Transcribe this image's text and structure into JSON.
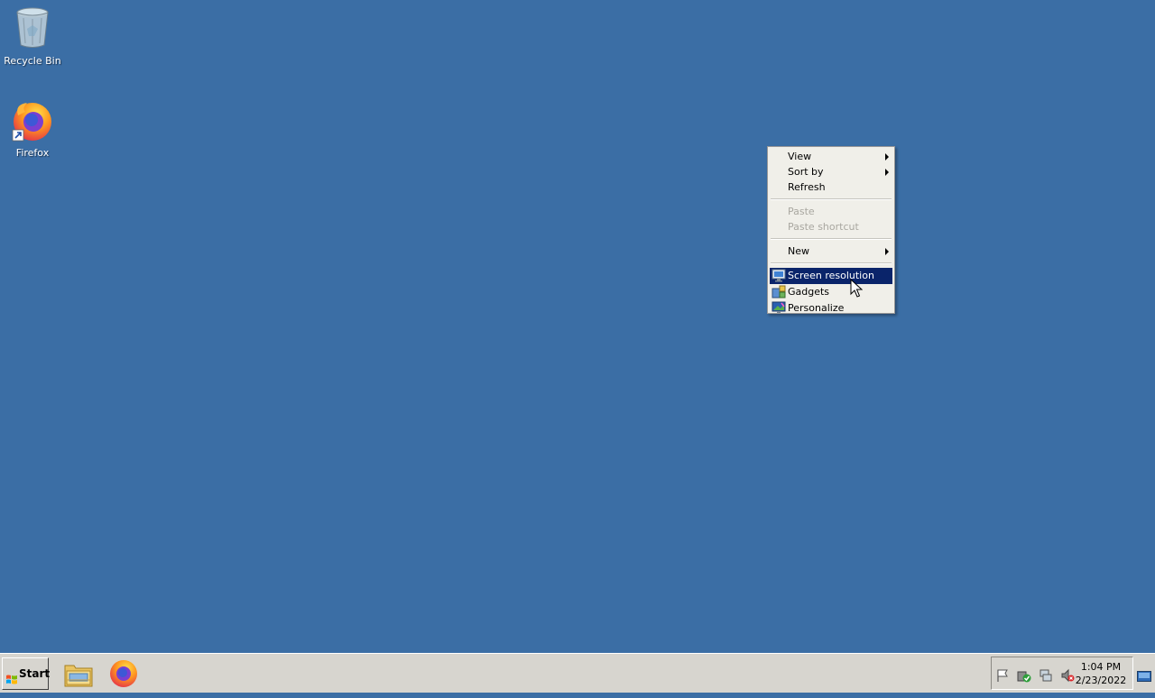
{
  "desktop": {
    "background_color": "#3b6ea5",
    "icons": [
      {
        "label": "Recycle Bin",
        "icon": "recycle-bin-icon"
      },
      {
        "label": "Firefox",
        "icon": "firefox-icon"
      }
    ]
  },
  "context_menu": {
    "items": [
      {
        "label": "View",
        "submenu": true,
        "enabled": true
      },
      {
        "label": "Sort by",
        "submenu": true,
        "enabled": true
      },
      {
        "label": "Refresh",
        "submenu": false,
        "enabled": true
      },
      {
        "label": "Paste",
        "submenu": false,
        "enabled": false
      },
      {
        "label": "Paste shortcut",
        "submenu": false,
        "enabled": false
      },
      {
        "label": "New",
        "submenu": true,
        "enabled": true
      },
      {
        "label": "Screen resolution",
        "icon": "screen-resolution-icon",
        "highlighted": true
      },
      {
        "label": "Gadgets",
        "icon": "gadgets-icon"
      },
      {
        "label": "Personalize",
        "icon": "personalize-icon"
      }
    ],
    "highlight_color": "#0a246a"
  },
  "taskbar": {
    "start_label": "Start",
    "pinned": [
      "file-explorer-icon",
      "firefox-icon"
    ],
    "tray_icons": [
      "action-center-flag-icon",
      "security-check-icon",
      "network-icon",
      "volume-muted-icon"
    ],
    "clock": {
      "time": "1:04 PM",
      "date": "2/23/2022"
    }
  }
}
